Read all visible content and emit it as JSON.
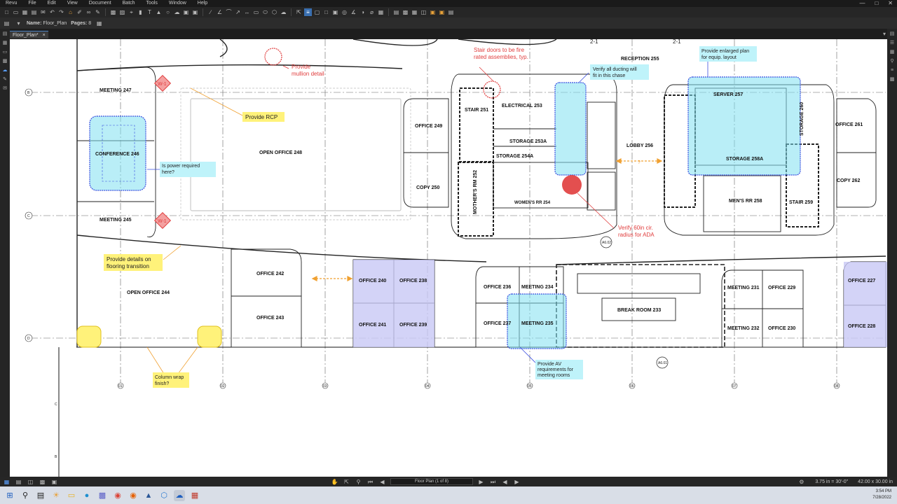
{
  "app": {
    "title": "Revu",
    "menu": [
      "Revu",
      "File",
      "Edit",
      "View",
      "Document",
      "Batch",
      "Tools",
      "Window",
      "Help"
    ]
  },
  "document": {
    "name_label": "Name:",
    "name_value": "Floor_Plan",
    "pages_label": "Pages:",
    "pages_value": "8",
    "tab_title": "Floor_Plan*"
  },
  "rooms": {
    "meeting_247": "MEETING 247",
    "conference_246": "CONFERENCE 246",
    "meeting_245": "MEETING 245",
    "open_office_248": "OPEN OFFICE 248",
    "office_249": "OFFICE 249",
    "copy_250": "COPY 250",
    "stair_251": "STAIR 251",
    "electrical_253": "ELECTRICAL 253",
    "storage_253a": "STORAGE 253A",
    "storage_254a": "STORAGE 254A",
    "mothers_rm_252": "MOTHER'S RM 252",
    "womens_rr_254": "WOMEN'S RR 254",
    "lobby_256": "LOBBY 256",
    "reception_255": "RECEPTION 255",
    "server_257": "SERVER 257",
    "storage_258a": "STORAGE 258A",
    "storage_260": "STORAGE 260",
    "mens_rr_258": "MEN'S RR 258",
    "stair_259": "STAIR 259",
    "office_261": "OFFICE 261",
    "copy_262": "COPY 262",
    "open_office_244": "OPEN OFFICE 244",
    "office_242": "OFFICE 242",
    "office_243": "OFFICE 243",
    "office_240": "OFFICE 240",
    "office_238": "OFFICE 238",
    "office_241": "OFFICE 241",
    "office_239": "OFFICE 239",
    "office_236": "OFFICE 236",
    "meeting_234": "MEETING 234",
    "office_237": "OFFICE 237",
    "meeting_235": "MEETING 235",
    "break_room_233": "BREAK ROOM 233",
    "meeting_231": "MEETING 231",
    "office_229": "OFFICE 229",
    "meeting_232": "MEETING 232",
    "office_230": "OFFICE 230",
    "office_227": "OFFICE 227",
    "office_228": "OFFICE 228"
  },
  "markups": {
    "provide_rcp": "Provide RCP",
    "power_required_1": "Is power required",
    "power_required_2": "here?",
    "mullion_1": "Provide",
    "mullion_2": "mullion detail",
    "stair_doors_1": "Stair doors to be fire",
    "stair_doors_2": "rated assemblies, typ.",
    "ducting_1": "Verify all ducting will",
    "ducting_2": "fit in this chase",
    "enlarged_plan_1": "Provide enlarged plan",
    "enlarged_plan_2": "for equip. layout",
    "ada_1": "Verify 60in cir.",
    "ada_2": "radius for ADA",
    "flooring_1": "Provide details on",
    "flooring_2": "flooring transition",
    "column_wrap_1": "Column wrap",
    "column_wrap_2": "finish?",
    "av_1": "Provide AV",
    "av_2": "requirements for",
    "av_3": "meeting rooms",
    "w1_tag": "W-1",
    "question_mark": "?"
  },
  "grid_tags": {
    "row_b": "B",
    "row_c": "C",
    "row_d": "D",
    "col_01": "01",
    "col_02": "02",
    "col_03": "03",
    "col_04": "04",
    "col_05": "05",
    "col_06": "06",
    "col_07": "07",
    "col_08": "08",
    "ref_a602": "A6.02",
    "ref_a601": "A6.01",
    "edge_c": "C",
    "edge_b": "B",
    "top_21a": "2-1",
    "top_21b": "2-1"
  },
  "status": {
    "page_label": "Floor Plan (1 of 8)",
    "scale": "3.75 in = 30'-0\"",
    "dimensions": "42.00 x 30.00 in"
  },
  "taskbar": {
    "time": "3:54 PM",
    "date": "7/28/2022"
  },
  "colors": {
    "cloud_blue": "#7fe0f0",
    "cloud_purple": "#c8c8f5",
    "markup_red": "#e03c3c",
    "markup_orange": "#f0a030",
    "note_yellow": "#fff27a",
    "note_cyan": "#bff3fa",
    "w1_fill": "#f4a0a0"
  }
}
